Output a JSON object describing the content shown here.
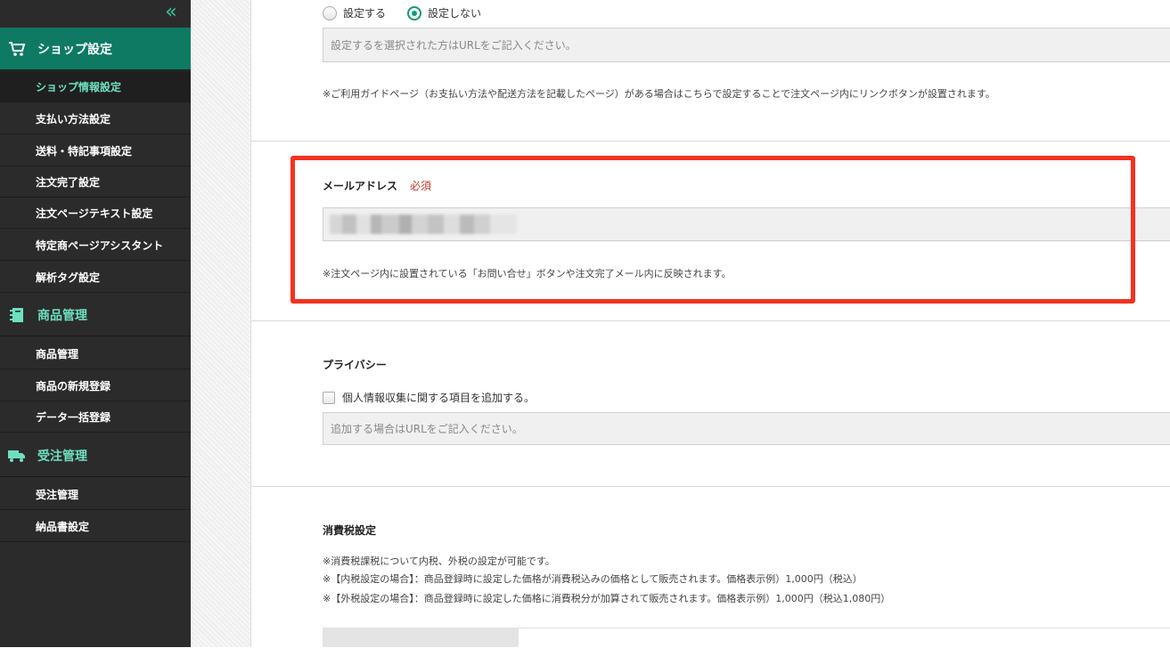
{
  "sidebar": {
    "collapse_icon": "«",
    "sections": [
      {
        "label": "ショップ設定",
        "icon": "cart-icon",
        "active": true,
        "items": [
          "ショップ情報設定",
          "支払い方法設定",
          "送料・特記事項設定",
          "注文完了設定",
          "注文ページテキスト設定",
          "特定商ページアシスタント",
          "解析タグ設定"
        ],
        "selected_index": 0
      },
      {
        "label": "商品管理",
        "icon": "notebook-icon",
        "active": false,
        "items": [
          "商品管理",
          "商品の新規登録",
          "データ一括登録"
        ]
      },
      {
        "label": "受注管理",
        "icon": "truck-icon",
        "active": false,
        "items": [
          "受注管理",
          "納品書設定"
        ]
      }
    ]
  },
  "guide_page": {
    "radio_set_label": "設定する",
    "radio_unset_label": "設定しない",
    "selected": "設定しない",
    "url_placeholder": "設定するを選択された方はURLをご記入ください。",
    "note": "※ご利用ガイドページ（お支払い方法や配送方法を記載したページ）がある場合はこちらで設定することで注文ページ内にリンクボタンが設置されます。"
  },
  "email": {
    "label": "メールアドレス",
    "required": "必須",
    "note": "※注文ページ内に設置されている「お問い合せ」ボタンや注文完了メール内に反映されます。"
  },
  "privacy": {
    "label": "プライバシー",
    "checkbox_label": "個人情報収集に関する項目を追加する。",
    "url_placeholder": "追加する場合はURLをご記入ください。"
  },
  "tax": {
    "label": "消費税設定",
    "notes": [
      "※消費税課税について内税、外税の設定が可能です。",
      "※【内税設定の場合】：商品登録時に設定した価格が消費税込みの価格として販売されます。価格表示例）1,000円（税込）",
      "※【外税設定の場合】：商品登録時に設定した価格に消費税分が加算されて販売されます。価格表示例）1,000円（税込1,080円）"
    ]
  },
  "colors": {
    "accent": "#0e7a63",
    "highlight": "#f4321f",
    "sidebar_bg": "#2b2b2b"
  }
}
